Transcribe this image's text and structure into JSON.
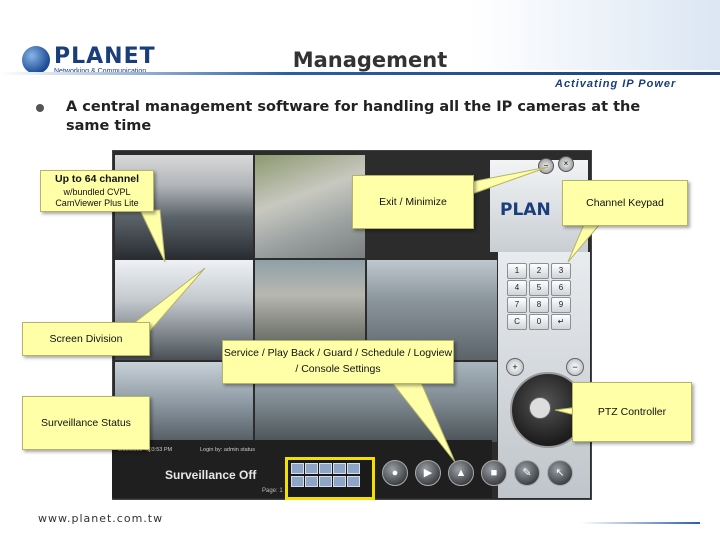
{
  "slide": {
    "title": "Management",
    "brand": "PLANET",
    "brand_sub": "Networking & Communication",
    "tagline": "Activating IP Power",
    "bullet": "A central management software for  handling all the IP cameras at the same time",
    "url": "www.planet.com.tw"
  },
  "callouts": {
    "channels_title": "Up to 64 channel",
    "channels_sub": "w/bundled CVPL CamViewer Plus Lite",
    "exit_minimize": "Exit / Minimize",
    "channel_keypad": "Channel Keypad",
    "screen_division": "Screen Division",
    "service": "Service / Play Back / Guard / Schedule / Logview / Console Settings",
    "surveillance_status": "Surveillance Status",
    "ptz_controller": "PTZ Controller"
  },
  "app": {
    "logo": "PLAN",
    "status_datetime": "3/30/2009 4:03:53 PM",
    "login_text": "Login by: admin status",
    "status": "Surveillance Off",
    "page_label": "Page: 1",
    "keypad": [
      "1",
      "2",
      "3",
      "4",
      "5",
      "6",
      "7",
      "8",
      "9",
      "C",
      "0",
      "↵"
    ],
    "zoom_in": "+",
    "zoom_out": "−",
    "toolbar": [
      "●",
      "▶",
      "▲",
      "■",
      "✎",
      "↖"
    ],
    "win_min": "−",
    "win_close": "×"
  },
  "colors": {
    "callout_bg": "#ffffa8",
    "highlight": "#f4e000",
    "brand": "#1a3d7c"
  }
}
